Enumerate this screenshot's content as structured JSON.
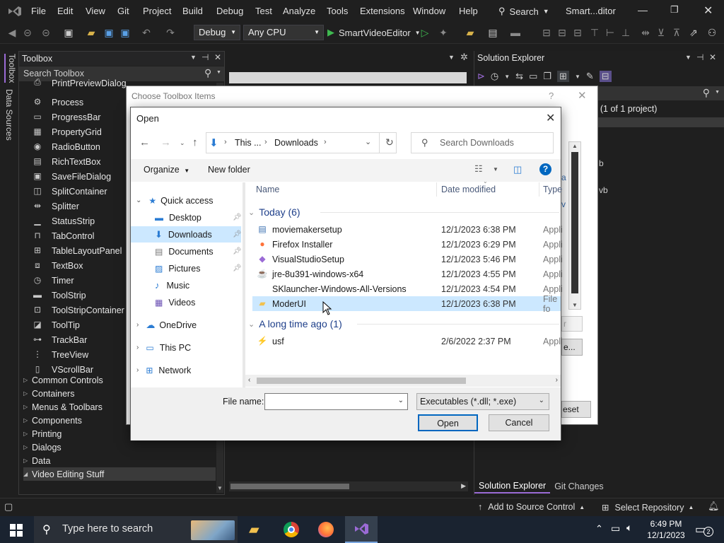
{
  "titlebar": {
    "menus": [
      "File",
      "Edit",
      "View",
      "Git",
      "Project",
      "Build",
      "Debug",
      "Test",
      "Analyze",
      "Tools",
      "Extensions",
      "Window",
      "Help"
    ],
    "search_label": "Search",
    "window_title": "Smart...ditor"
  },
  "toolbar": {
    "config": "Debug",
    "platform": "Any CPU",
    "run_target": "SmartVideoEditor"
  },
  "left_strip": {
    "tab1": "Toolbox",
    "tab2": "Data Sources"
  },
  "toolbox": {
    "title": "Toolbox",
    "search_placeholder": "Search Toolbox",
    "items": [
      {
        "label": "PrintPreviewDialog",
        "icon": "printpreview-icon"
      },
      {
        "label": "Process",
        "icon": "gear-icon"
      },
      {
        "label": "ProgressBar",
        "icon": "progressbar-icon"
      },
      {
        "label": "PropertyGrid",
        "icon": "propertygrid-icon"
      },
      {
        "label": "RadioButton",
        "icon": "radio-icon"
      },
      {
        "label": "RichTextBox",
        "icon": "richtext-icon"
      },
      {
        "label": "SaveFileDialog",
        "icon": "savefile-icon"
      },
      {
        "label": "SplitContainer",
        "icon": "splitcontainer-icon"
      },
      {
        "label": "Splitter",
        "icon": "splitter-icon"
      },
      {
        "label": "StatusStrip",
        "icon": "statusstrip-icon"
      },
      {
        "label": "TabControl",
        "icon": "tabcontrol-icon"
      },
      {
        "label": "TableLayoutPanel",
        "icon": "tablelayout-icon"
      },
      {
        "label": "TextBox",
        "icon": "textbox-icon"
      },
      {
        "label": "Timer",
        "icon": "timer-icon"
      },
      {
        "label": "ToolStrip",
        "icon": "toolstrip-icon"
      },
      {
        "label": "ToolStripContainer",
        "icon": "toolstripcontainer-icon"
      },
      {
        "label": "ToolTip",
        "icon": "tooltip-icon"
      },
      {
        "label": "TrackBar",
        "icon": "trackbar-icon"
      },
      {
        "label": "TreeView",
        "icon": "treeview-icon"
      },
      {
        "label": "VScrollBar",
        "icon": "vscrollbar-icon"
      }
    ],
    "groups": [
      "Common Controls",
      "Containers",
      "Menus & Toolbars",
      "Components",
      "Printing",
      "Dialogs",
      "Data",
      "Video Editing Stuff"
    ]
  },
  "solution_explorer": {
    "title": "Solution Explorer",
    "summary_fragment": "' (1 of 1 project)",
    "frag1": "b",
    "frag2": "vb",
    "tab_active": "Solution Explorer",
    "tab_other": "Git Changes"
  },
  "choose_dialog": {
    "title": "Choose Toolbox Items",
    "help": "?",
    "frag_r": "r",
    "frag_e": "e...",
    "frag_reset": "eset"
  },
  "open_dialog": {
    "title": "Open",
    "address": {
      "seg1": "This ...",
      "seg2": "Downloads"
    },
    "search_placeholder": "Search Downloads",
    "organize_label": "Organize",
    "new_folder_label": "New folder",
    "nav": {
      "quick_access": "Quick access",
      "desktop": "Desktop",
      "downloads": "Downloads",
      "documents": "Documents",
      "pictures": "Pictures",
      "music": "Music",
      "videos": "Videos",
      "onedrive": "OneDrive",
      "thispc": "This PC",
      "network": "Network"
    },
    "columns": {
      "name": "Name",
      "date": "Date modified",
      "type": "Type"
    },
    "group1": "Today (6)",
    "group2": "A long time ago (1)",
    "files_today": [
      {
        "name": "moviemakersetup",
        "date": "12/1/2023 6:38 PM",
        "type": "Appli",
        "icon": "installer-icon"
      },
      {
        "name": "Firefox Installer",
        "date": "12/1/2023 6:29 PM",
        "type": "Appli",
        "icon": "firefox-icon"
      },
      {
        "name": "VisualStudioSetup",
        "date": "12/1/2023 5:46 PM",
        "type": "Appli",
        "icon": "visualstudio-icon"
      },
      {
        "name": "jre-8u391-windows-x64",
        "date": "12/1/2023 4:55 PM",
        "type": "Appli",
        "icon": "java-icon"
      },
      {
        "name": "SKlauncher-Windows-All-Versions",
        "date": "12/1/2023 4:54 PM",
        "type": "Appli",
        "icon": "blank-icon"
      },
      {
        "name": "ModerUI",
        "date": "12/1/2023 6:38 PM",
        "type": "File fo",
        "icon": "folder-icon"
      }
    ],
    "files_old": [
      {
        "name": "usf",
        "date": "2/6/2022 2:37 PM",
        "type": "Appli",
        "icon": "usf-icon"
      }
    ],
    "filename_label": "File name:",
    "filename_value": "",
    "filter": "Executables (*.dll; *.exe)",
    "open_btn": "Open",
    "cancel_btn": "Cancel"
  },
  "statusbar": {
    "source_control": "Add to Source Control",
    "repo": "Select Repository"
  },
  "taskbar": {
    "search_placeholder": "Type here to search",
    "time": "6:49 PM",
    "date": "12/1/2023",
    "notification_count": "2"
  },
  "colors": {
    "vs_purple": "#9b6bd6",
    "selection_blue": "#cce8ff",
    "accent_blue": "#0067c0"
  }
}
